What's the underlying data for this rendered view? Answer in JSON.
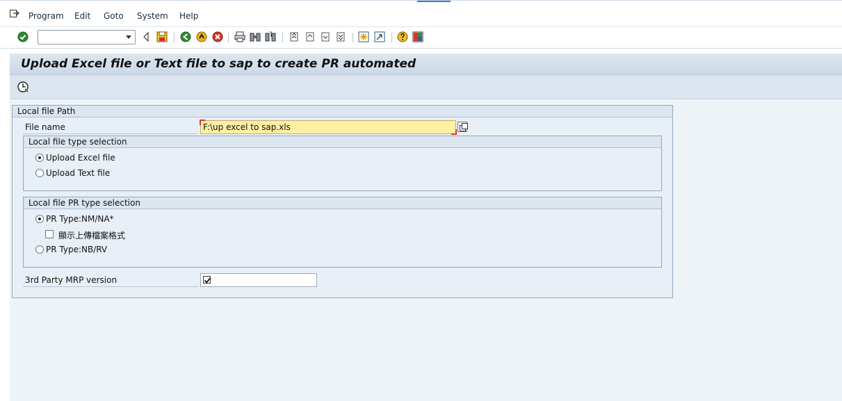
{
  "menu": {
    "items": [
      {
        "label": "Program"
      },
      {
        "label": "Edit"
      },
      {
        "label": "Goto"
      },
      {
        "label": "System"
      },
      {
        "label": "Help"
      }
    ]
  },
  "toolbar": {
    "command_field_value": ""
  },
  "screen": {
    "title": "Upload Excel file or Text file to sap to create PR automated"
  },
  "local_file_path": {
    "header": "Local file Path",
    "file_name_label": "File name",
    "file_name_value": "F:\\up excel to sap.xls"
  },
  "file_type_selection": {
    "header": "Local file type selection",
    "options": [
      {
        "label": "Upload Excel file",
        "selected": true
      },
      {
        "label": "Upload Text file",
        "selected": false
      }
    ]
  },
  "pr_type_selection": {
    "header": "Local file PR type selection",
    "option_nm": {
      "label": "PR Type:NM/NA*",
      "selected": true
    },
    "show_format_checkbox": {
      "label": "顯示上傳檔案格式",
      "checked": false
    },
    "option_nb": {
      "label": "PR Type:NB/RV",
      "selected": false
    }
  },
  "mrp_version": {
    "label": "3rd Party MRP version",
    "checked": true
  },
  "colors": {
    "required_field_bg": "#fdf0a3",
    "panel_bg": "#eef3f8",
    "title_bar": "#cbd8e6"
  }
}
